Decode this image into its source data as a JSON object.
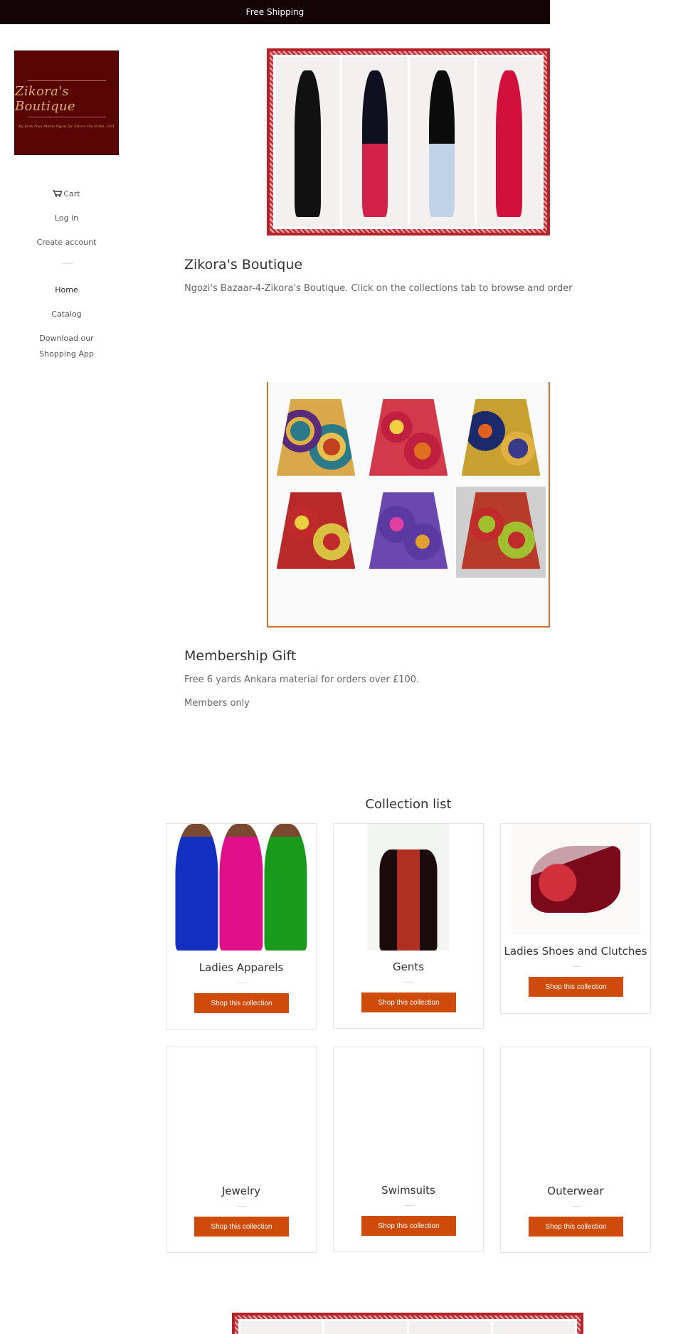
{
  "announcement": "Free Shipping",
  "logo": {
    "name": "Zikora's Boutique",
    "tagline": "By Erok Nwa Mama Ngozi for Zikora Olu Ezike, USA"
  },
  "nav": {
    "cart": "Cart",
    "login": "Log in",
    "create_account": "Create account",
    "home": "Home",
    "catalog": "Catalog",
    "download_line1": "Download our",
    "download_line2": "Shopping App"
  },
  "section1": {
    "title": "Zikora's Boutique",
    "text": "Ngozi's Bazaar-4-Zikora's Boutique. Click on the collections tab to browse and order"
  },
  "section2": {
    "title": "Membership Gift",
    "text1": "Free 6 yards Ankara material for orders over £100.",
    "text2": "Members only"
  },
  "collection_list": {
    "title": "Collection list",
    "button_label": "Shop this collection",
    "items": [
      {
        "name": "Ladies Apparels"
      },
      {
        "name": "Gents"
      },
      {
        "name": "Ladies Shoes and Clutches"
      },
      {
        "name": "Jewelry"
      },
      {
        "name": "Swimsuits"
      },
      {
        "name": "Outerwear"
      }
    ]
  },
  "colors": {
    "announcement_bg": "#140505",
    "logo_bg": "#5a0505",
    "button_bg": "#cf4b0b",
    "frame_red": "#b4232a",
    "frame_orange": "#d0712a"
  }
}
